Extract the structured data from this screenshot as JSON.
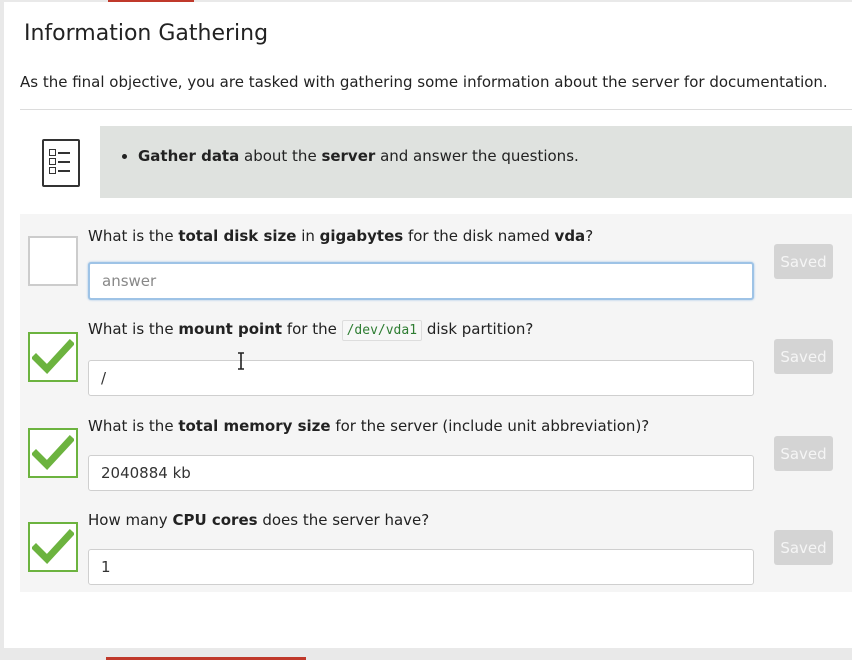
{
  "page": {
    "title": "Information Gathering",
    "intro": "As the final objective, you are tasked with gathering some information about the server for documentation."
  },
  "instructions": {
    "icon": "checklist-icon",
    "bullet": {
      "b1": "Gather data",
      "t1": " about the ",
      "b2": "server",
      "t2": " and answer the questions."
    }
  },
  "questions": [
    {
      "parts": {
        "t1": "What is the ",
        "b1": "total disk size",
        "t2": " in ",
        "b2": "gigabytes",
        "t3": " for the disk named ",
        "b3": "vda",
        "t4": "?"
      },
      "answer": "",
      "placeholder": "answer",
      "completed": false,
      "button": "Saved"
    },
    {
      "parts": {
        "t1": "What is the ",
        "b1": "mount point",
        "t2": " for the ",
        "code": "/dev/vda1",
        "t3": " disk partition?"
      },
      "answer": "/",
      "placeholder": "answer",
      "completed": true,
      "button": "Saved"
    },
    {
      "parts": {
        "t1": "What is the ",
        "b1": "total memory size",
        "t2": " for the server (include unit abbreviation)?"
      },
      "answer": "2040884 kb",
      "placeholder": "answer",
      "completed": true,
      "button": "Saved"
    },
    {
      "parts": {
        "t1": "How many ",
        "b1": "CPU cores",
        "t2": " does the server have?"
      },
      "answer": "1",
      "placeholder": "answer",
      "completed": true,
      "button": "Saved"
    }
  ],
  "colors": {
    "accent": "#c0392b",
    "check": "#6cb33f",
    "callout": "#dfe2df",
    "code": "#2e7d32",
    "saved_button": "#d4d4d4"
  }
}
